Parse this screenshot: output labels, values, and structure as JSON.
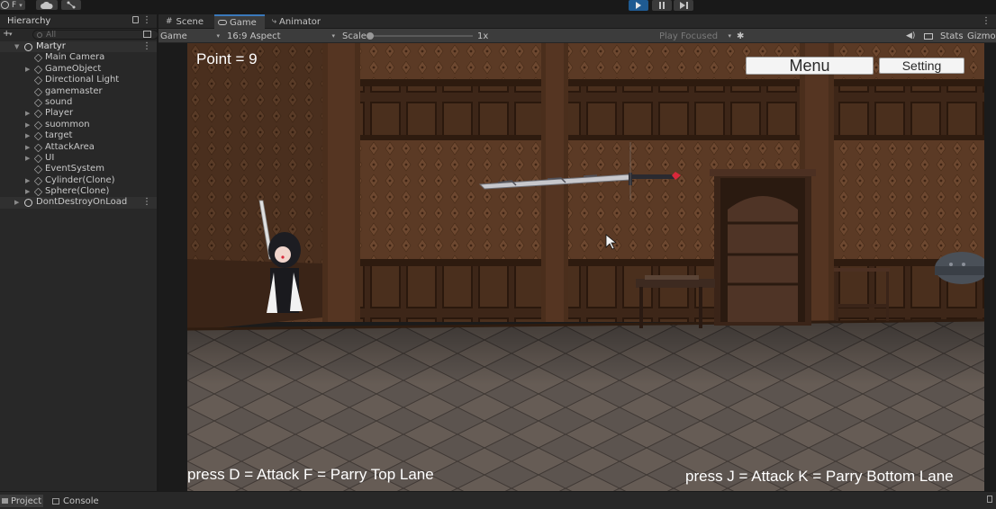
{
  "toolbar": {
    "account_label": "F",
    "account_icon": "account-circle-icon",
    "cloud_icon": "cloud-icon",
    "collab_icon": "version-control-icon",
    "play_icon": "play-icon",
    "pause_icon": "pause-icon",
    "step_icon": "step-icon"
  },
  "hierarchy": {
    "tab_label": "Hierarchy",
    "search_placeholder": "All",
    "scene_name": "Martyr",
    "items": [
      {
        "label": "Main Camera",
        "expandable": false
      },
      {
        "label": "GameObject",
        "expandable": true
      },
      {
        "label": "Directional Light",
        "expandable": false
      },
      {
        "label": "gamemaster",
        "expandable": false
      },
      {
        "label": "sound",
        "expandable": false
      },
      {
        "label": "Player",
        "expandable": true
      },
      {
        "label": "suommon",
        "expandable": true
      },
      {
        "label": "target",
        "expandable": true
      },
      {
        "label": "AttackArea",
        "expandable": true
      },
      {
        "label": "UI",
        "expandable": true
      },
      {
        "label": "EventSystem",
        "expandable": false
      },
      {
        "label": "Cylinder(Clone)",
        "expandable": true
      },
      {
        "label": "Sphere(Clone)",
        "expandable": true
      }
    ],
    "dont_destroy": "DontDestroyOnLoad"
  },
  "view_tabs": [
    {
      "label": "Scene",
      "icon": "grid-icon"
    },
    {
      "label": "Game",
      "icon": "game-controller-icon"
    },
    {
      "label": "Animator",
      "icon": "animator-icon"
    }
  ],
  "game_toolbar": {
    "display": "Game",
    "aspect": "16:9 Aspect",
    "scale_label": "Scale",
    "scale_value": "1x",
    "scale_fraction": 0.0,
    "play_mode": "Play Focused",
    "stats": "Stats",
    "gizmos": "Gizmos"
  },
  "game_ui": {
    "point_text": "Point = 9",
    "menu_label": "Menu",
    "setting_label": "Setting",
    "help_left": "press  D = Attack F = Parry Top  Lane",
    "help_right": "press J = Attack K = Parry Bottom Lane"
  },
  "bottom_tabs": [
    {
      "label": "Project",
      "icon": "folder-icon"
    },
    {
      "label": "Console",
      "icon": "console-icon"
    }
  ],
  "colors": {
    "editor_bg": "#282828",
    "tab_active_accent": "#3a79bb",
    "play_active": "#1f5b92",
    "wallpaper": "#5a3a24",
    "wood_panel": "#4a2e1c",
    "floor": "#5e5650"
  }
}
